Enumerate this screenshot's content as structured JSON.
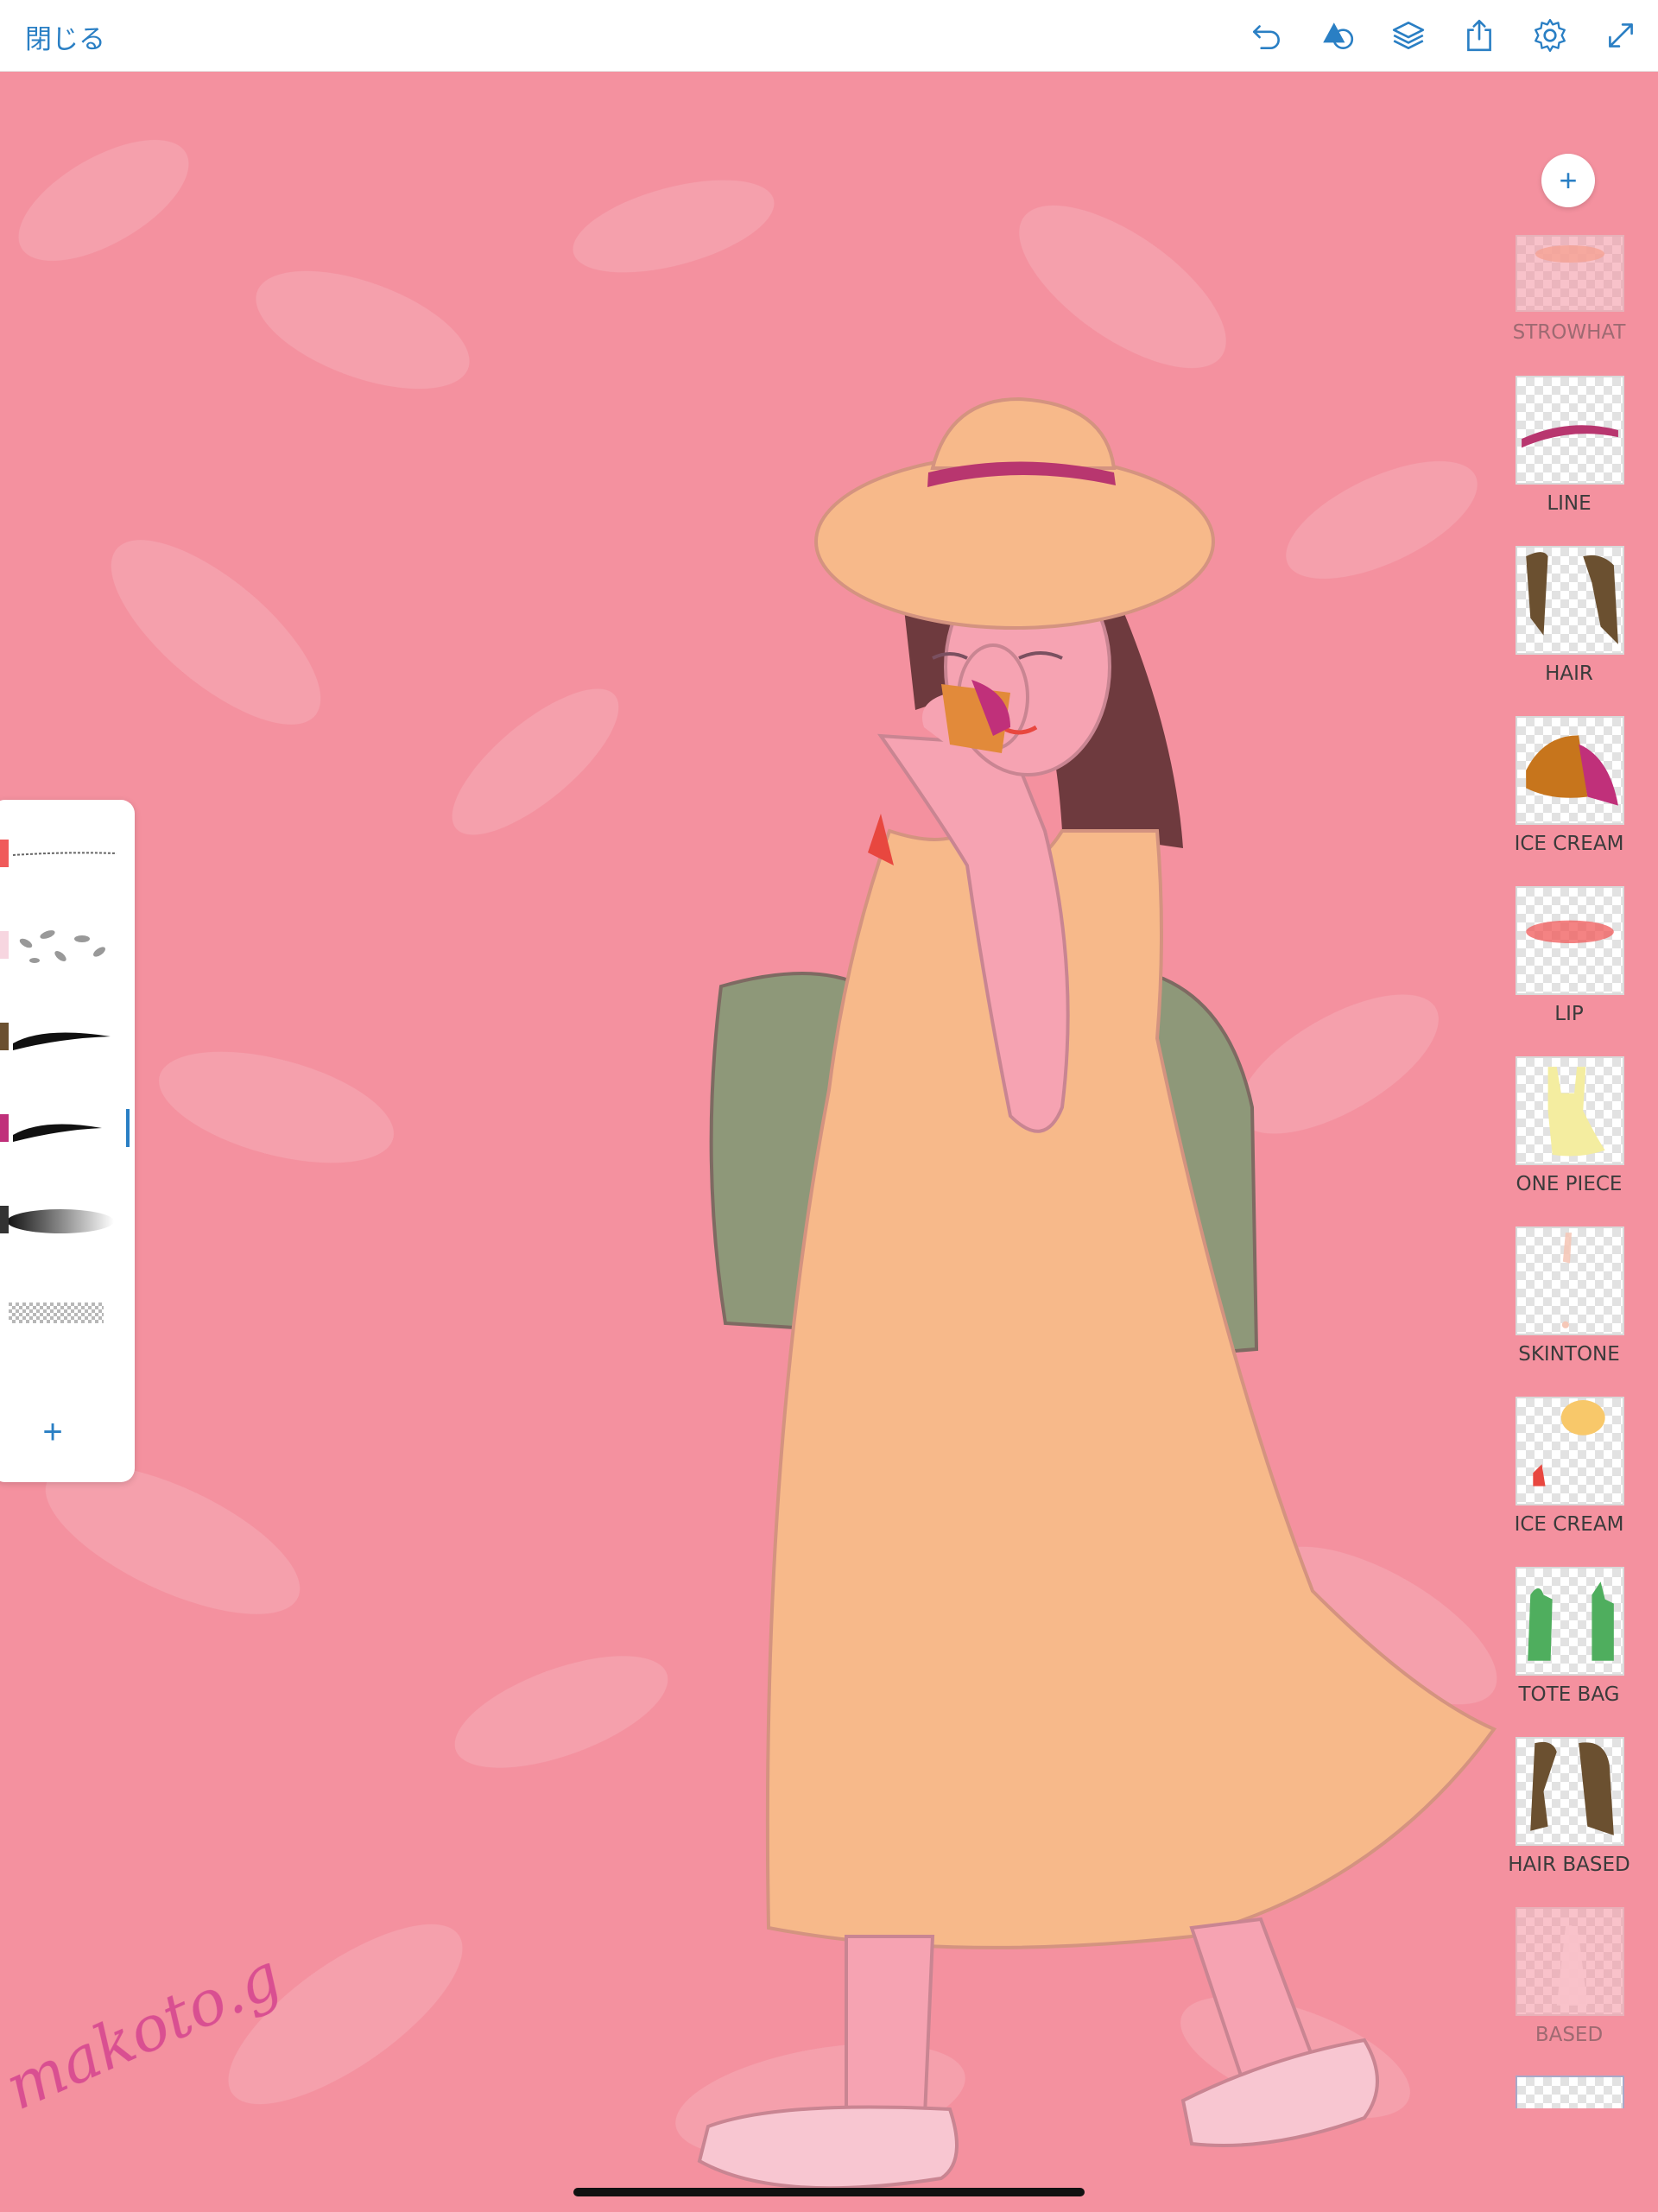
{
  "topbar": {
    "close_label": "閉じる",
    "tools": [
      "undo-icon",
      "shapes-icon",
      "layers-icon",
      "share-icon",
      "settings-icon",
      "fullscreen-icon"
    ]
  },
  "colors": {
    "accent": "#2a7fc4",
    "canvas_bg": "#f4919f",
    "dress": "#f7b98a",
    "bag": "#8e9879",
    "hair": "#6e3a3e",
    "hat_band": "#b8366f",
    "signature": "#d94f91"
  },
  "brushes": [
    {
      "name": "brush-pencil",
      "color": "#f05a5a"
    },
    {
      "name": "brush-leaf-scatter",
      "color": "#f7d6e0"
    },
    {
      "name": "brush-ink-brown",
      "color": "#6b5030"
    },
    {
      "name": "brush-ink-magenta",
      "color": "#c0307a",
      "active": true
    },
    {
      "name": "brush-airbrush",
      "color": "#333333"
    },
    {
      "name": "brush-eraser",
      "color": "#ffffff"
    }
  ],
  "layers": [
    {
      "label": "STROWHAT",
      "faded": true
    },
    {
      "label": "LINE"
    },
    {
      "label": "HAIR"
    },
    {
      "label": "ICE CREAM"
    },
    {
      "label": "LIP"
    },
    {
      "label": "ONE PIECE"
    },
    {
      "label": "SKINTONE"
    },
    {
      "label": "ICE CREAM"
    },
    {
      "label": "TOTE BAG"
    },
    {
      "label": "HAIR BASED"
    },
    {
      "label": "BASED",
      "faded": true
    }
  ],
  "signature": "makoto.g"
}
